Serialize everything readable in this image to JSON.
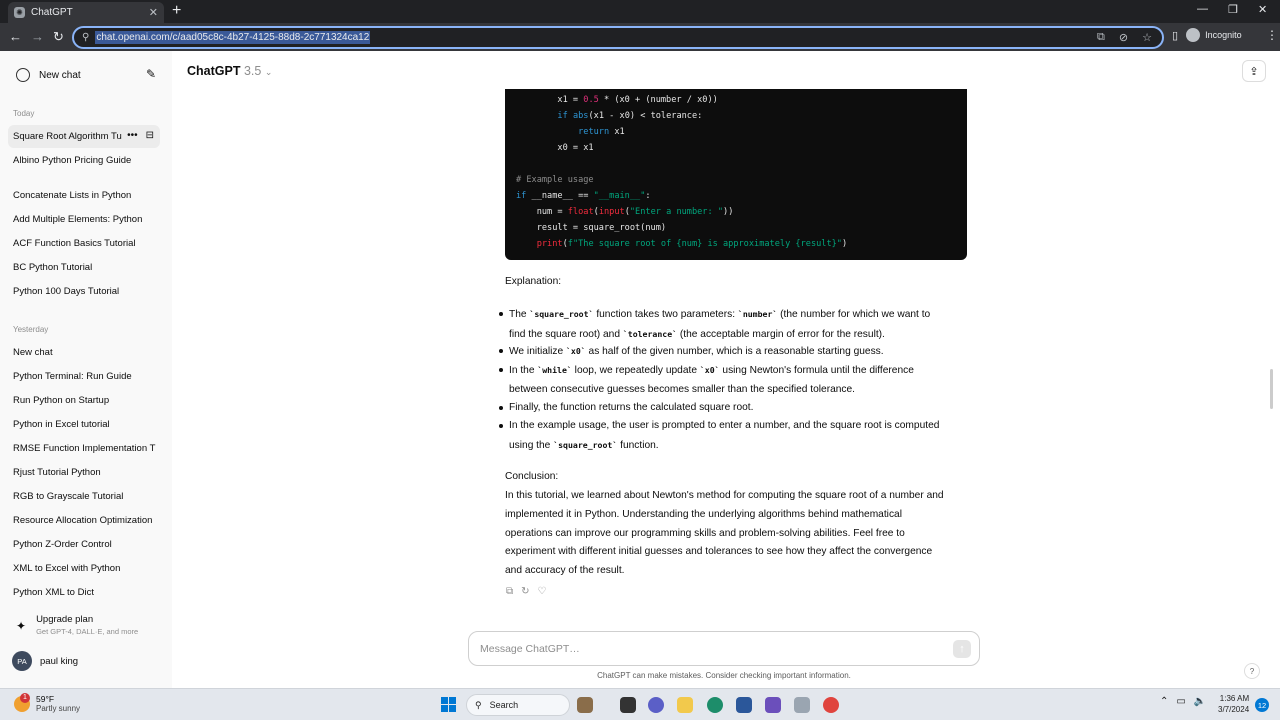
{
  "browser": {
    "tab_title": "ChatGPT",
    "url": "chat.openai.com/c/aad05c8c-4b27-4125-88d8-2c771324ca12",
    "profile_label": "Incognito"
  },
  "sidebar": {
    "new_chat_label": "New chat",
    "today_label": "Today",
    "today_items": [
      "Square Root Algorithm Tu",
      "Albino Python Pricing Guide",
      "Concatenate Lists in Python",
      "Add Multiple Elements: Python",
      "ACF Function Basics Tutorial",
      "BC Python Tutorial",
      "Python 100 Days Tutorial"
    ],
    "yesterday_label": "Yesterday",
    "yesterday_items": [
      "New chat",
      "Python Terminal: Run Guide",
      "Run Python on Startup",
      "Python in Excel tutorial",
      "RMSE Function Implementation T",
      "Rjust Tutorial Python",
      "RGB to Grayscale Tutorial",
      "Resource Allocation Optimization",
      "Python Z-Order Control",
      "XML to Excel with Python",
      "Python XML to Dict"
    ],
    "upgrade_title": "Upgrade plan",
    "upgrade_subtitle": "Get GPT-4, DALL·E, and more",
    "user_initials": "PA",
    "user_name": "paul king"
  },
  "header": {
    "model_name": "ChatGPT",
    "model_version": "3.5"
  },
  "code_lines": [
    "        x1 = 0.5 * (x0 + (number / x0))",
    "        if abs(x1 - x0) < tolerance:",
    "            return x1",
    "        x0 = x1",
    "",
    "# Example usage",
    "if __name__ == \"__main__\":",
    "    num = float(input(\"Enter a number: \"))",
    "    result = square_root(num)",
    "    print(f\"The square root of {num} is approximately {result}\")"
  ],
  "explanation": {
    "heading": "Explanation:",
    "b1_pre": "The ",
    "b1_code1": "`square_root`",
    "b1_mid1": " function takes two parameters: ",
    "b1_code2": "`number`",
    "b1_mid2": " (the number for which we want to",
    "b1_line2_pre": "find the square root) and ",
    "b1_code3": "`tolerance`",
    "b1_line2_post": " (the acceptable margin of error for the result).",
    "b2_pre": "We initialize ",
    "b2_code": "`x0`",
    "b2_post": " as half of the given number, which is a reasonable starting guess.",
    "b3_pre": "In the ",
    "b3_code1": "`while`",
    "b3_mid": " loop, we repeatedly update ",
    "b3_code2": "`x0`",
    "b3_post": " using Newton's formula until the difference",
    "b3_line2": "between consecutive guesses becomes smaller than the specified tolerance.",
    "b4": "Finally, the function returns the calculated square root.",
    "b5_line1": "In the example usage, the user is prompted to enter a number, and the square root is computed",
    "b5_pre": "using the ",
    "b5_code": "`square_root`",
    "b5_post": " function."
  },
  "conclusion": {
    "heading": "Conclusion:",
    "lines": [
      "In this tutorial, we learned about Newton's method for computing the square root of a number and",
      "implemented it in Python. Understanding the underlying algorithms behind mathematical",
      "operations can improve our programming skills and problem-solving abilities. Feel free to",
      "experiment with different initial guesses and tolerances to see how they affect the convergence",
      "and accuracy of the result."
    ]
  },
  "composer": {
    "placeholder": "Message ChatGPT…",
    "disclaimer": "ChatGPT can make mistakes. Consider checking important information.",
    "help": "?"
  },
  "taskbar": {
    "temperature": "59°F",
    "condition": "Partly sunny",
    "weather_badge": "1",
    "search_label": "Search",
    "time": "1:36 AM",
    "date": "3/7/2024",
    "notification_count": "12"
  }
}
